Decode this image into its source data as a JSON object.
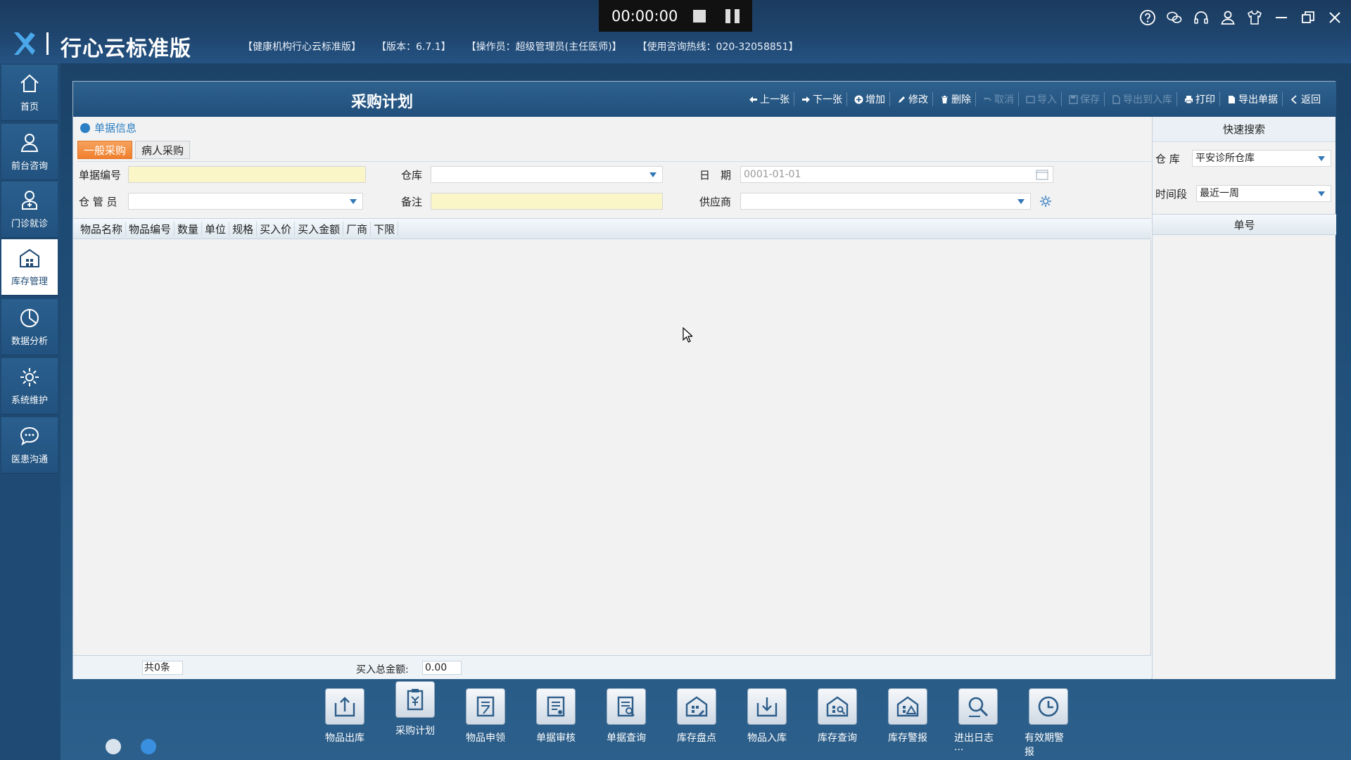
{
  "recorder": {
    "time": "00:00:00"
  },
  "app": {
    "title": "行心云标准版",
    "org": "【健康机构行心云标准版】",
    "version": "【版本：6.7.1】",
    "operator": "【操作员：超级管理员(主任医师)】",
    "hotline": "【使用咨询热线：020-32058851】"
  },
  "nav": [
    {
      "label": "首页",
      "icon": "home-icon"
    },
    {
      "label": "前台咨询",
      "icon": "reception-icon"
    },
    {
      "label": "门诊就诊",
      "icon": "doctor-icon"
    },
    {
      "label": "库存管理",
      "icon": "warehouse-icon",
      "active": true
    },
    {
      "label": "数据分析",
      "icon": "chart-icon"
    },
    {
      "label": "系统维护",
      "icon": "gear-icon"
    },
    {
      "label": "医患沟通",
      "icon": "chat-icon"
    }
  ],
  "page": {
    "title": "采购计划",
    "toolbar": {
      "prev": "上一张",
      "next": "下一张",
      "add": "增加",
      "edit": "修改",
      "delete": "删除",
      "cancel": "取消",
      "import": "导入",
      "save": "保存",
      "export_in": "导出到入库",
      "print": "打印",
      "export_doc": "导出单据",
      "back": "返回"
    },
    "section": "单据信息",
    "tabs": [
      "一般采购",
      "病人采购"
    ],
    "form": {
      "doc_no_label": "单据编号",
      "warehouse_label": "仓库",
      "date_label": "日　期",
      "date_value": "0001-01-01",
      "keeper_label": "仓 管 员",
      "remark_label": "备注",
      "supplier_label": "供应商"
    },
    "columns": [
      "物品名称",
      "物品编号",
      "数量",
      "单位",
      "规格",
      "买入价",
      "买入金额",
      "厂商",
      "下限"
    ],
    "footer": {
      "count": "共0条",
      "total_label": "买入总金额:",
      "total_value": "0.00"
    }
  },
  "quick_search": {
    "title": "快速搜索",
    "warehouse_label": "仓 库",
    "warehouse_value": "平安诊所仓库",
    "period_label": "时间段",
    "period_value": "最近一周",
    "column": "单号"
  },
  "dock": [
    "物品出库",
    "采购计划",
    "物品申领",
    "单据审核",
    "单据查询",
    "库存盘点",
    "物品入库",
    "库存查询",
    "库存警报",
    "进出日志···",
    "有效期警报"
  ]
}
